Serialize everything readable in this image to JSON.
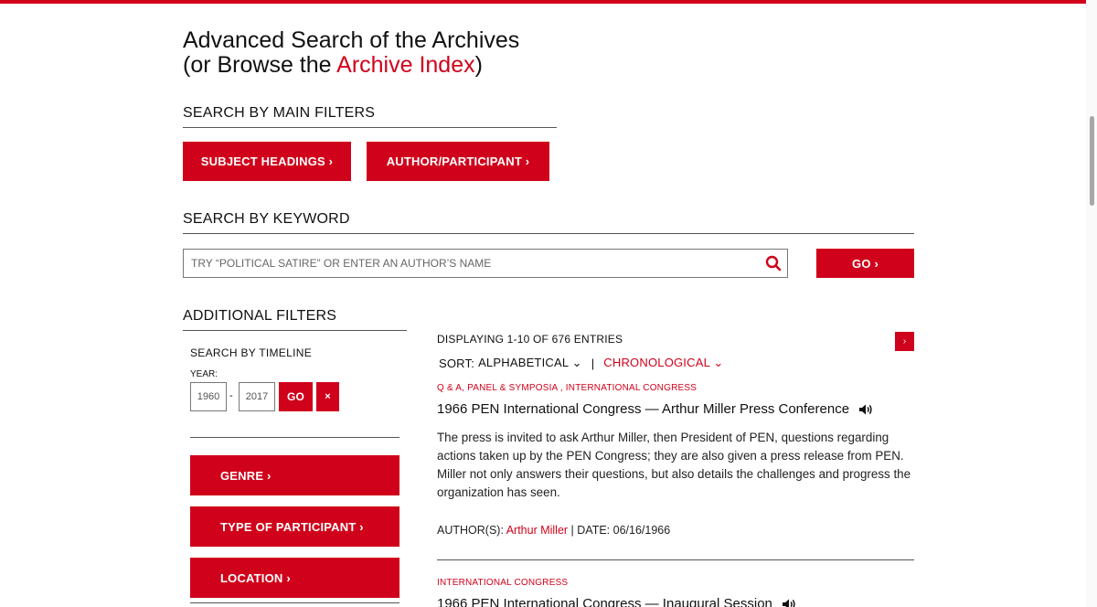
{
  "header": {
    "title_line1": "Advanced Search of the Archives",
    "title_prefix": "(or Browse the ",
    "title_link": "Archive Index",
    "title_suffix": ")"
  },
  "main_filters": {
    "heading": "SEARCH BY MAIN FILTERS",
    "subject_label": "SUBJECT HEADINGS ›",
    "author_label": "AUTHOR/PARTICIPANT ›"
  },
  "keyword": {
    "heading": "SEARCH BY KEYWORD",
    "placeholder": "TRY “POLITICAL SATIRE” OR ENTER AN AUTHOR’S NAME",
    "go_label": "GO ›"
  },
  "additional": {
    "heading": "ADDITIONAL FILTERS",
    "timeline_heading": "SEARCH BY TIMELINE",
    "year_label": "YEAR:",
    "year_from": "1960",
    "year_sep": "-",
    "year_to": "2017",
    "go_label": "GO",
    "clear_label": "×",
    "genre_label": "GENRE ›",
    "type_label": "TYPE OF PARTICIPANT ›",
    "location_label": "LOCATION ›"
  },
  "results": {
    "displaying": "DISPLAYING 1-10 OF 676 ENTRIES",
    "next_label": "›",
    "sort_label": "SORT:",
    "sort_alpha": "ALPHABETICAL ⌄",
    "sort_sep": "|",
    "sort_chrono": "CHRONOLOGICAL ⌄",
    "entries": [
      {
        "categories": "Q & A, PANEL & SYMPOSIA , INTERNATIONAL CONGRESS",
        "title": "1966 PEN International Congress — Arthur Miller Press Conference",
        "description": "The press is invited to ask Arthur Miller, then President of PEN, questions regarding actions taken up by the PEN Congress; they are also given a press release from PEN. Miller not only answers their questions, but also details the challenges and progress the organization has seen.",
        "author_label": "AUTHOR(S): ",
        "author_name": "Arthur Miller",
        "date_text": " | DATE: 06/16/1966"
      },
      {
        "categories": "INTERNATIONAL CONGRESS",
        "title": "1966 PEN International Congress — Inaugural Session"
      }
    ]
  },
  "colors": {
    "accent": "#d0021b",
    "text": "#111111"
  },
  "icons": {
    "search": "search-icon",
    "audio": "speaker-icon"
  }
}
